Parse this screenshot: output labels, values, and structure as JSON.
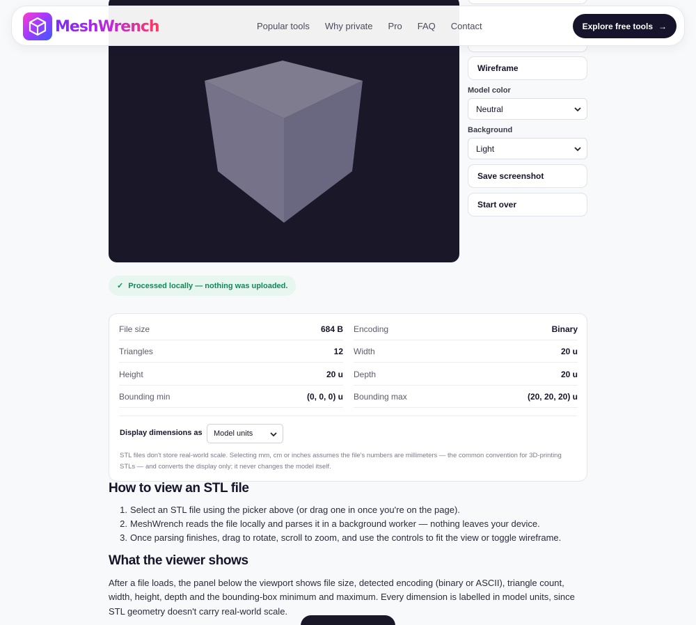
{
  "brand": {
    "name": "MeshWrench"
  },
  "nav": {
    "items": [
      "Popular tools",
      "Why private",
      "Pro",
      "FAQ",
      "Contact"
    ],
    "cta_label": "Explore free tools",
    "cta_arrow": "→"
  },
  "controls": {
    "wireframe_label": "Wireframe",
    "model_color_label": "Model color",
    "model_color_value": "Neutral",
    "background_label": "Background",
    "background_value": "Light",
    "screenshot_label": "Save screenshot",
    "start_over_label": "Start over"
  },
  "privacy": {
    "check": "✓",
    "text": "Processed locally — nothing was uploaded."
  },
  "stats": {
    "rows": [
      {
        "left": {
          "label": "File size",
          "value": "684 B"
        },
        "right": {
          "label": "Encoding",
          "value": "Binary"
        }
      },
      {
        "left": {
          "label": "Triangles",
          "value": "12"
        },
        "right": {
          "label": "Width",
          "value": "20 u"
        }
      },
      {
        "left": {
          "label": "Height",
          "value": "20 u"
        },
        "right": {
          "label": "Depth",
          "value": "20 u"
        }
      },
      {
        "left": {
          "label": "Bounding min",
          "value": "(0, 0, 0) u"
        },
        "right": {
          "label": "Bounding max",
          "value": "(20, 20, 20) u"
        }
      }
    ],
    "units_label": "Display dimensions as",
    "units_value": "Model units",
    "units_note": "STL files don't store real-world scale. Selecting mm, cm or inches assumes the file's numbers are millimeters — the common convention for 3D-printing STLs — and converts the display only; it never changes the model itself."
  },
  "howto": {
    "title": "How to view an STL file",
    "steps": [
      {
        "n": "1.",
        "text": "Select an STL file using the picker above (or drag one in once you're on the page)."
      },
      {
        "n": "2.",
        "text": "MeshWrench reads the file locally and parses it in a background worker — nothing leaves your device."
      },
      {
        "n": "3.",
        "text": "Once parsing finishes, drag to rotate, scroll to zoom, and use the controls to fit the view or toggle wireframe."
      }
    ]
  },
  "viewer": {
    "title": "What the viewer shows",
    "paragraph": "After a file loads, the panel below the viewport shows file size, detected encoding (binary or ASCII), triangle count, width, height, depth and the bounding-box minimum and maximum. Every dimension is labelled in model units, since STL geometry doesn't carry real-world scale."
  },
  "colors": {
    "viewport_bg": "#1a1729",
    "cube_top": "#807c90",
    "cube_left": "#75728a",
    "cube_right": "#6a6780",
    "privacy_green": "#13875b",
    "cta_bg": "#15142a"
  }
}
